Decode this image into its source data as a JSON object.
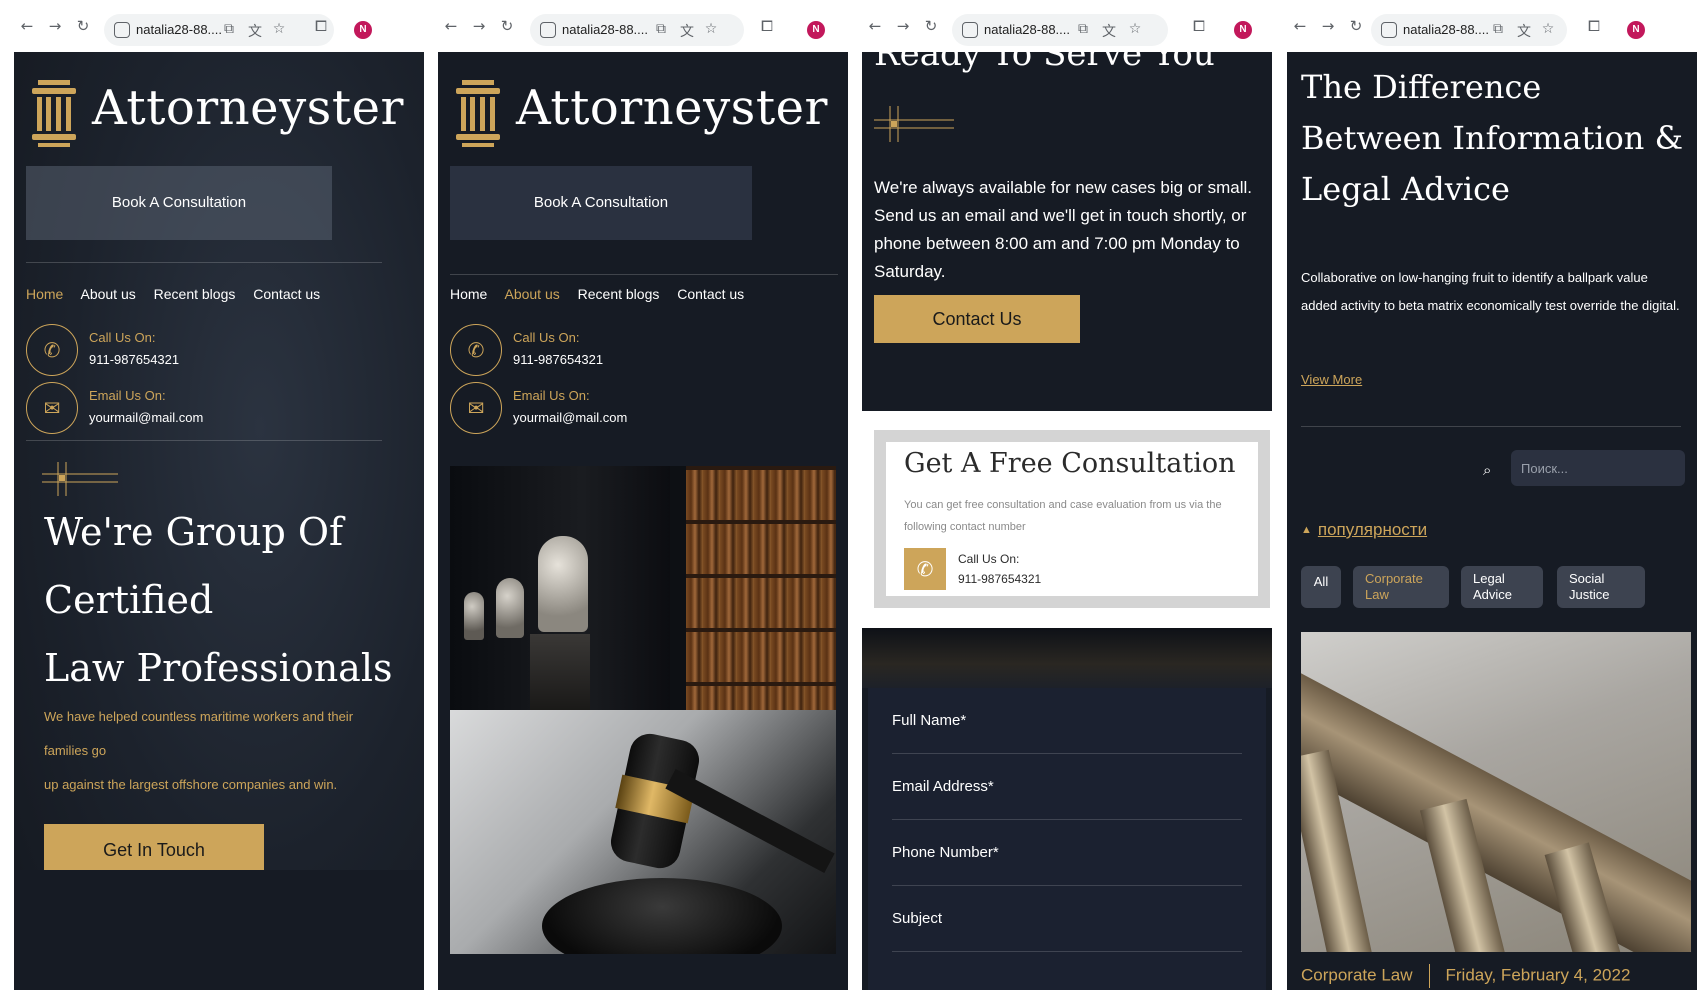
{
  "browser": {
    "url_text": "natalia28-88....",
    "profile_initial": "N"
  },
  "site": {
    "brand": "Attorneyster",
    "book_button": "Book A Consultation",
    "nav": [
      "Home",
      "About us",
      "Recent blogs",
      "Contact us"
    ],
    "call_label": "Call Us On:",
    "call_number": "911-987654321",
    "email_label": "Email Us On:",
    "email_value": "yourmail@mail.com"
  },
  "col1": {
    "active_nav": "Home",
    "hero_title": [
      "We're Group Of",
      "Certified",
      "Law Professionals"
    ],
    "hero_text": [
      "We have helped countless maritime workers and their",
      "families go",
      "up against the largest offshore companies and win."
    ],
    "cta": "Get In Touch"
  },
  "col2": {
    "active_nav": "About us"
  },
  "col3": {
    "heading": "Ready To Serve You",
    "text": "We're always available for new cases big or small. Send us an email and we'll get in touch shortly, or phone between 8:00 am and 7:00 pm Monday to Saturday.",
    "cta": "Contact Us",
    "consult_title": "Get A Free Consultation",
    "consult_text": "You can get free consultation and case evaluation from us via the following contact number",
    "consult_call_label": "Call Us On:",
    "consult_call_number": "911-987654321",
    "form_fields": [
      "Full Name*",
      "Email Address*",
      "Phone Number*",
      "Subject"
    ]
  },
  "col4": {
    "title": "The Difference Between Information & Legal Advice",
    "text": "Collaborative on low-hanging fruit to identify a ballpark value added activity to beta matrix economically test override the digital.",
    "link": "View More",
    "search_placeholder": "Поиск...",
    "sort_label": "популярности",
    "chips": [
      "All",
      "Corporate Law",
      "Legal Advice",
      "Social Justice"
    ],
    "meta_category": "Corporate Law",
    "meta_date": "Friday, February 4, 2022"
  },
  "colors": {
    "accent": "#cda55a",
    "page_bg": "#161b24",
    "profile": "#c2185b"
  },
  "icons": [
    "back-arrow-icon",
    "forward-arrow-icon",
    "reload-icon",
    "site-settings-icon",
    "install-icon",
    "translate-icon",
    "star-icon",
    "extensions-icon",
    "phone-icon",
    "mail-icon",
    "search-icon",
    "caret-up-icon",
    "pillar-logo-icon"
  ]
}
